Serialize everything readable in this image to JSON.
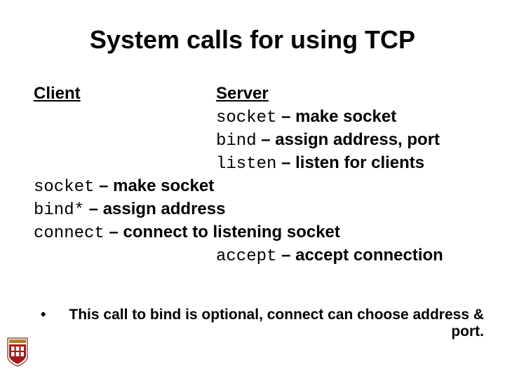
{
  "title": "System calls for using TCP",
  "headers": {
    "client": "Client",
    "server": "Server"
  },
  "server_lines": {
    "l1_code": "socket",
    "l1_text": " – make socket",
    "l2_code": "bind",
    "l2_text": " – assign address, port",
    "l3_code": "listen",
    "l3_text": " – listen for clients",
    "l4_code": "accept",
    "l4_text": " – accept connection"
  },
  "client_lines": {
    "l1_code": "socket",
    "l1_text": " – make socket",
    "l2_code": "bind*",
    "l2_text": " – assign address",
    "l3_code": "connect",
    "l3_text": " – connect to listening socket"
  },
  "note": {
    "bullet": "•",
    "text": "This call to bind is optional, connect can choose address & port."
  }
}
